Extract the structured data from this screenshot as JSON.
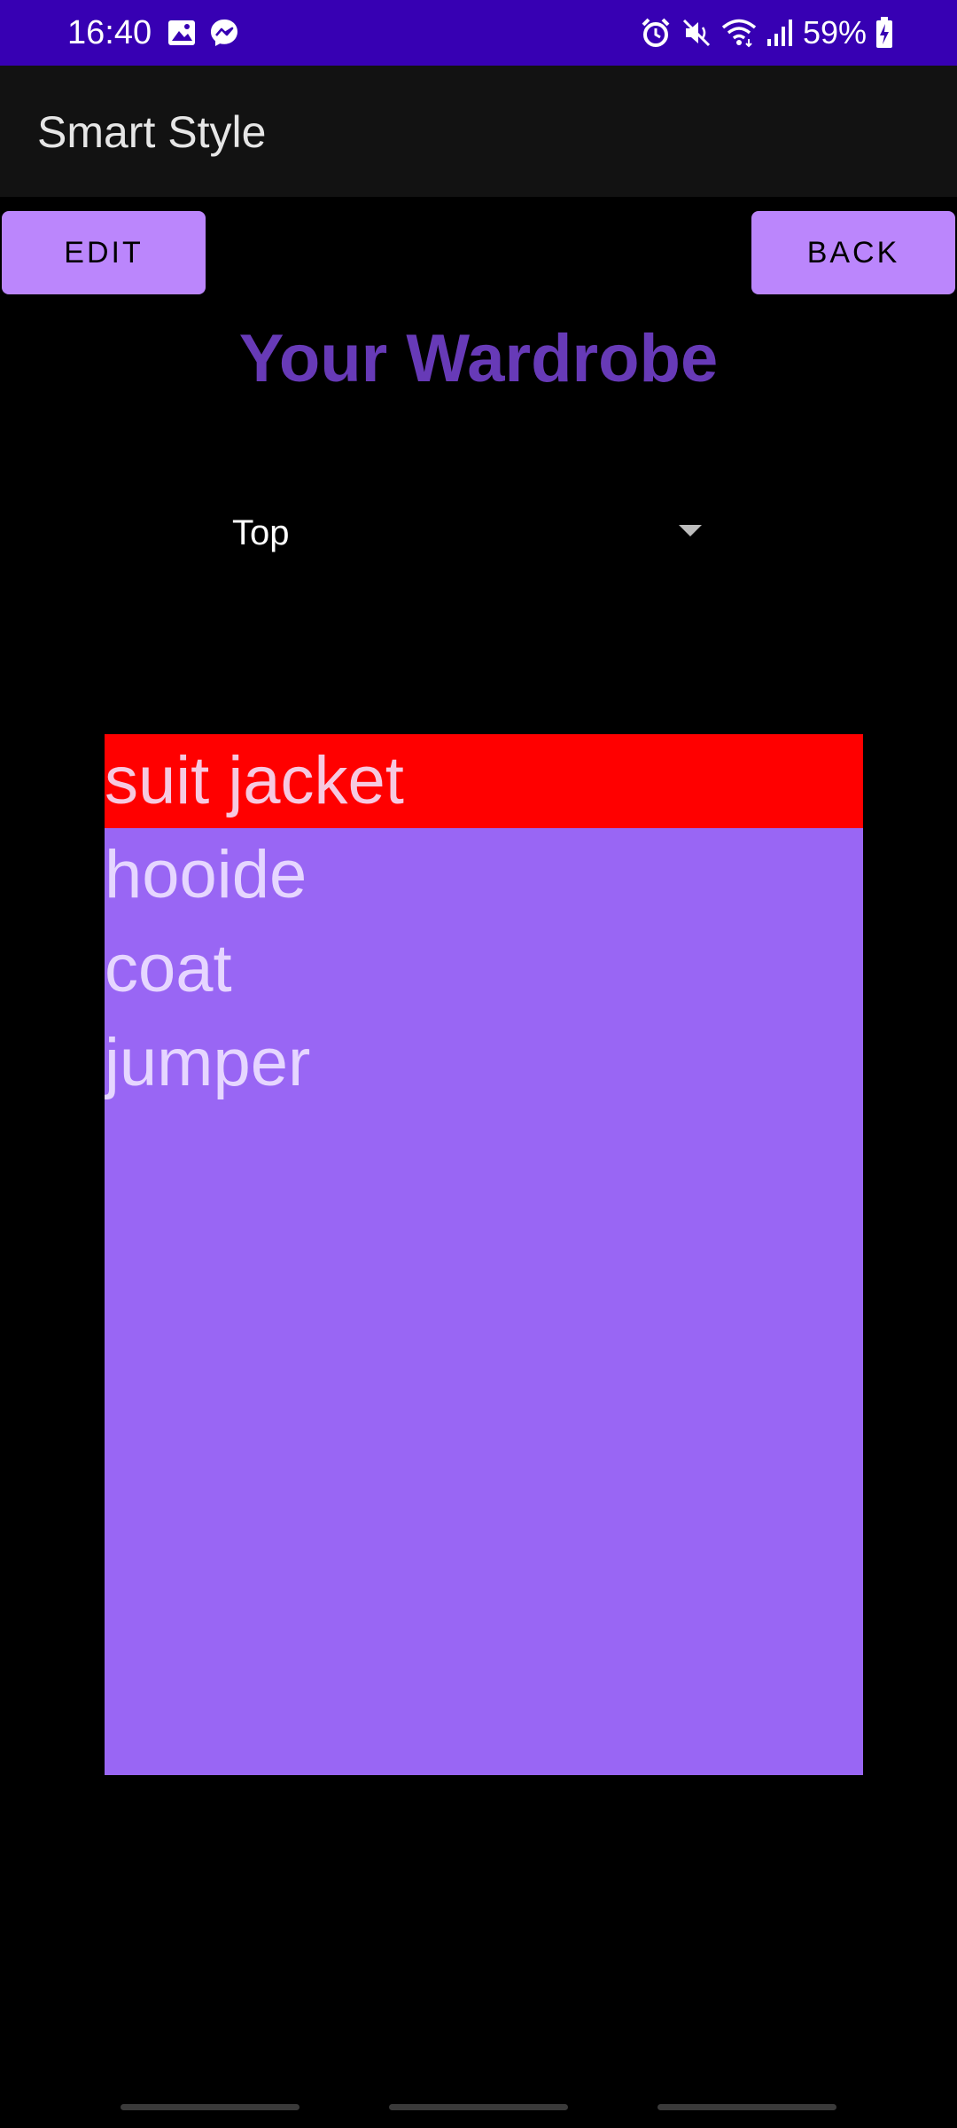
{
  "status_bar": {
    "time": "16:40",
    "battery_percent": "59%",
    "color": "#3700b3",
    "left_icons": [
      "gallery-icon",
      "messenger-icon"
    ],
    "right_icons": [
      "alarm-icon",
      "mute-icon",
      "wifi-icon",
      "signal-icon",
      "battery-charging-icon"
    ]
  },
  "app_bar": {
    "title": "Smart Style"
  },
  "toolbar": {
    "edit_label": "EDIT",
    "back_label": "BACK"
  },
  "heading": "Your Wardrobe",
  "category_spinner": {
    "selected": "Top"
  },
  "wardrobe_list": {
    "items": [
      {
        "label": "suit jacket",
        "selected": true
      },
      {
        "label": "hooide",
        "selected": false
      },
      {
        "label": "coat",
        "selected": false
      },
      {
        "label": "jumper",
        "selected": false
      }
    ]
  },
  "colors": {
    "accent": "#bb86fc",
    "heading": "#673ab7",
    "list_background": "#9966f4",
    "selected_item": "#ff0000"
  }
}
